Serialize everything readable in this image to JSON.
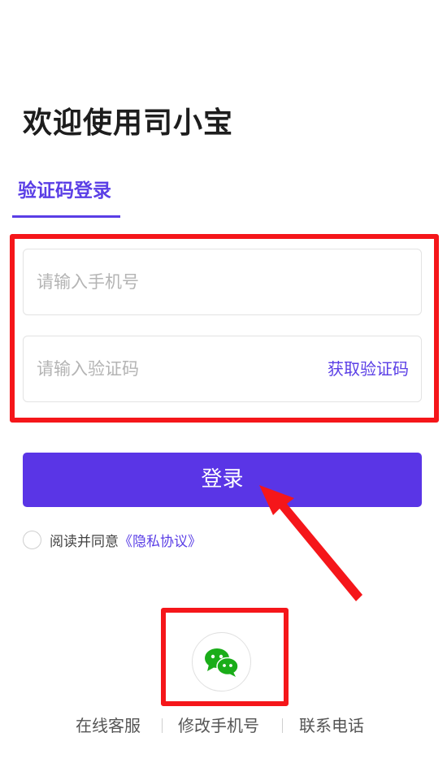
{
  "header": {
    "title": "欢迎使用司小宝"
  },
  "tabs": [
    {
      "label": "验证码登录",
      "active": true
    }
  ],
  "form": {
    "phone": {
      "placeholder": "请输入手机号",
      "value": ""
    },
    "code": {
      "placeholder": "请输入验证码",
      "value": "",
      "action_label": "获取验证码"
    },
    "login_label": "登录"
  },
  "agreement": {
    "checked": false,
    "prefix": "阅读并同意",
    "link_label": "《隐私协议》"
  },
  "social": {
    "icon": "wechat-icon"
  },
  "footer": {
    "links": [
      "在线客服",
      "修改手机号",
      "联系电话"
    ]
  },
  "colors": {
    "accent": "#5a35e6",
    "highlight": "#f5161a",
    "wechat": "#1aad19"
  }
}
